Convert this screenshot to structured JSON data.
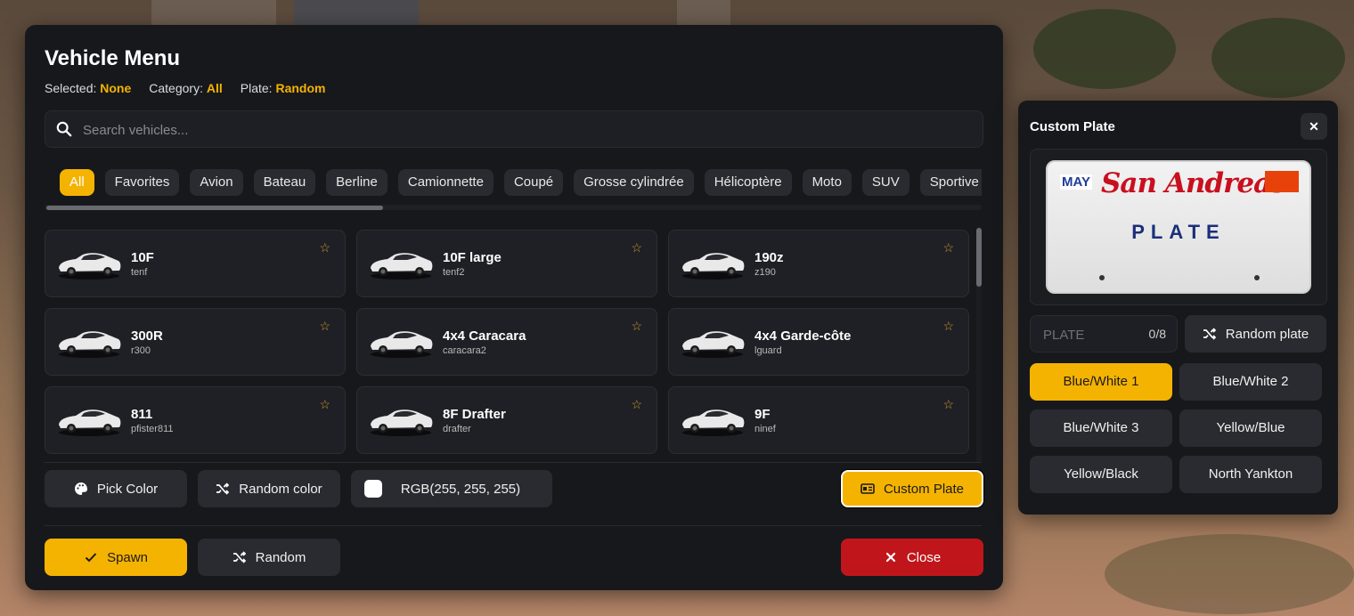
{
  "menu": {
    "title": "Vehicle Menu",
    "selected_label": "Selected:",
    "selected_value": "None",
    "category_label": "Category:",
    "category_value": "All",
    "plate_label": "Plate:",
    "plate_value": "Random",
    "search_placeholder": "Search vehicles...",
    "categories": [
      "All",
      "Favorites",
      "Avion",
      "Bateau",
      "Berline",
      "Camionnette",
      "Coupé",
      "Grosse cylindrée",
      "Hélicoptère",
      "Moto",
      "SUV",
      "Sportive"
    ],
    "active_category": "All",
    "vehicles": [
      {
        "name": "10F",
        "code": "tenf"
      },
      {
        "name": "10F large",
        "code": "tenf2"
      },
      {
        "name": "190z",
        "code": "z190"
      },
      {
        "name": "300R",
        "code": "r300"
      },
      {
        "name": "4x4 Caracara",
        "code": "caracara2"
      },
      {
        "name": "4x4 Garde-côte",
        "code": "lguard"
      },
      {
        "name": "811",
        "code": "pfister811"
      },
      {
        "name": "8F Drafter",
        "code": "drafter"
      },
      {
        "name": "9F",
        "code": "ninef"
      }
    ],
    "star_glyph": "☆",
    "pick_color_label": "Pick Color",
    "random_color_label": "Random color",
    "rgb_label": "RGB(255, 255, 255)",
    "custom_plate_label": "Custom Plate",
    "spawn_label": "Spawn",
    "random_label": "Random",
    "close_label": "Close"
  },
  "plate_panel": {
    "title": "Custom Plate",
    "close_glyph": "✕",
    "plate_header": "MAY",
    "plate_state": "San Andreas",
    "plate_text": "PLATE",
    "input_placeholder": "PLATE",
    "counter": "0/8",
    "random_plate_label": "Random plate",
    "styles": [
      "Blue/White 1",
      "Blue/White 2",
      "Blue/White 3",
      "Yellow/Blue",
      "Yellow/Black",
      "North Yankton"
    ],
    "active_style": "Blue/White 1"
  },
  "colors": {
    "accent": "#f5b301",
    "danger": "#c0161b",
    "panel": "#17181c",
    "card": "#1f2025"
  }
}
